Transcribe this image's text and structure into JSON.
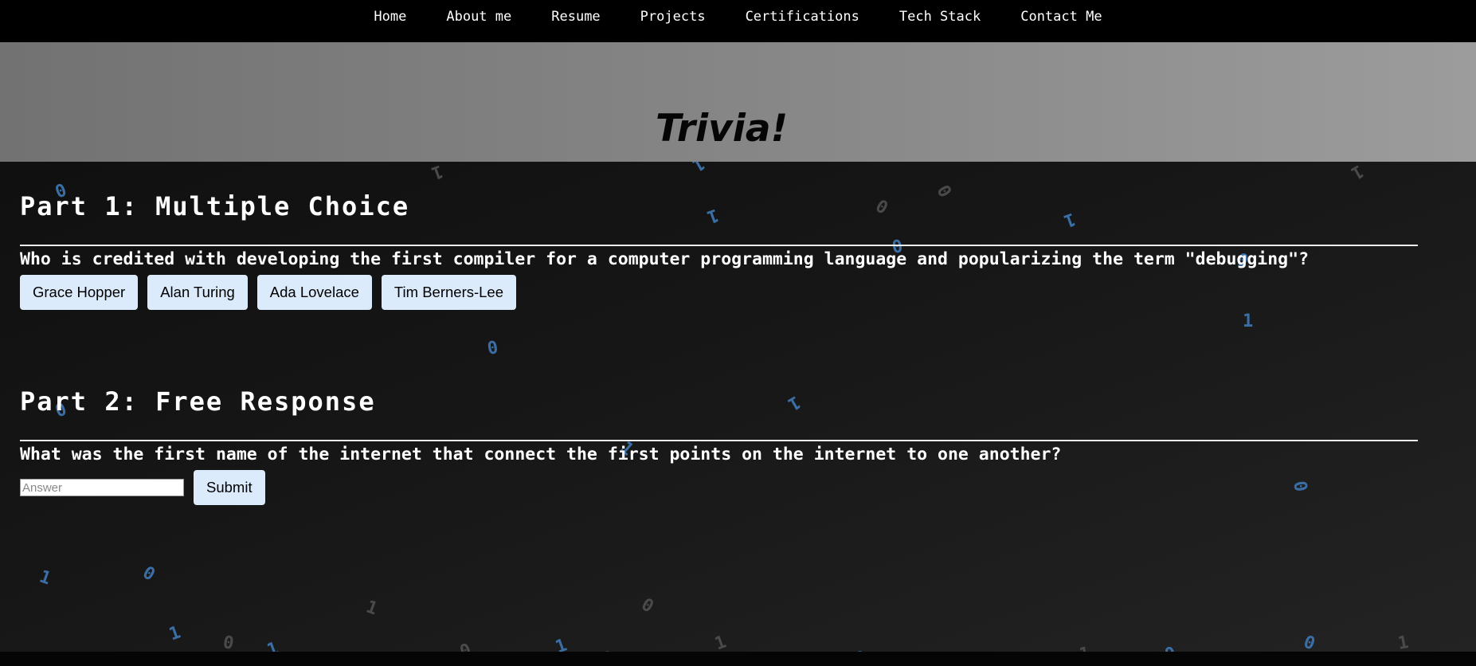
{
  "nav": {
    "items": [
      {
        "label": "Home"
      },
      {
        "label": "About me"
      },
      {
        "label": "Resume"
      },
      {
        "label": "Projects"
      },
      {
        "label": "Certifications"
      },
      {
        "label": "Tech Stack"
      },
      {
        "label": "Contact Me"
      }
    ]
  },
  "hero": {
    "title": "Trivia!"
  },
  "part1": {
    "title": "Part 1: Multiple Choice",
    "question": "Who is credited with developing the first compiler for a computer programming language and popularizing the term \"debugging\"?",
    "choices": [
      {
        "label": "Grace Hopper"
      },
      {
        "label": "Alan Turing"
      },
      {
        "label": "Ada Lovelace"
      },
      {
        "label": "Tim Berners-Lee"
      }
    ]
  },
  "part2": {
    "title": "Part 2: Free Response",
    "question": "What was the first name of the internet that connect the first points on the internet to one another?",
    "answer_value": "",
    "answer_placeholder": "Answer",
    "submit_label": "Submit"
  },
  "background": {
    "digits": [
      "0",
      "1",
      "0",
      "1",
      "0",
      "1",
      "0",
      "1",
      "0",
      "1",
      "0",
      "1",
      "0",
      "1",
      "0",
      "1",
      "0",
      "1",
      "0",
      "1",
      "0",
      "1",
      "0",
      "1",
      "0",
      "1",
      "0",
      "1",
      "0",
      "1",
      "0",
      "1",
      "0",
      "1",
      "0",
      "1"
    ],
    "colors": {
      "blue": "#3a6ea5",
      "gray": "#4a4a4a"
    }
  },
  "colors": {
    "nav_bg": "#000000",
    "hero_bg": "#808080",
    "button_bg": "#dcebfb",
    "page_bg": "#151515",
    "text": "#ffffff"
  }
}
